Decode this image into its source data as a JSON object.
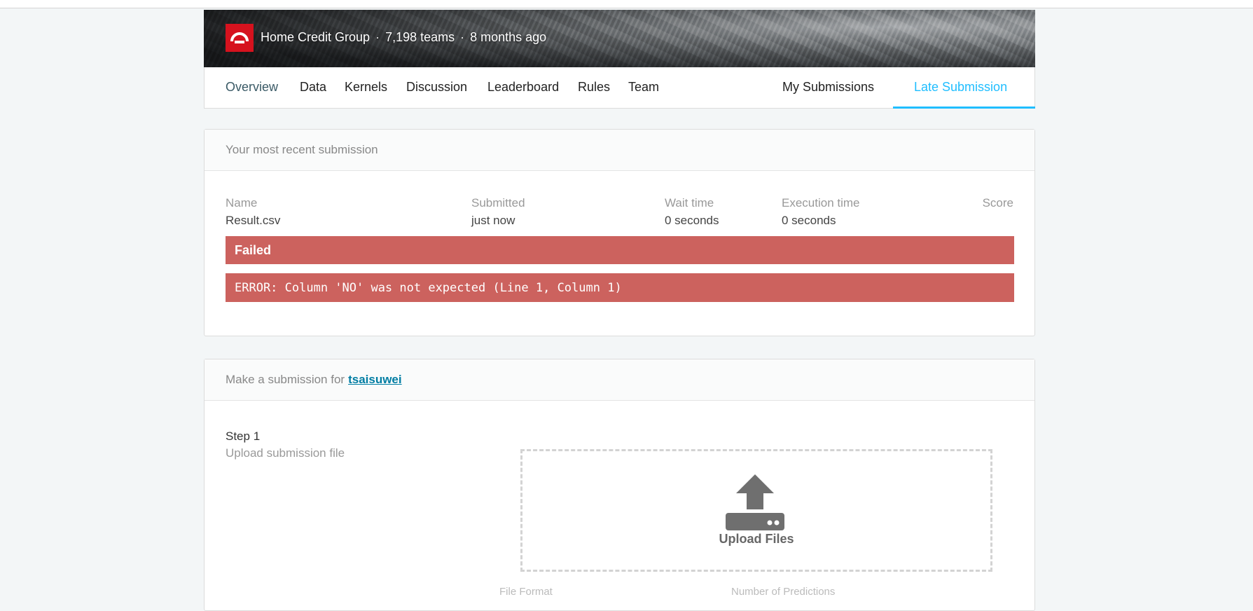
{
  "header": {
    "org": "Home Credit Group",
    "teams": "7,198 teams",
    "time": "8 months ago",
    "separator": "·"
  },
  "tabs": {
    "overview": "Overview",
    "data": "Data",
    "kernels": "Kernels",
    "discussion": "Discussion",
    "leaderboard": "Leaderboard",
    "rules": "Rules",
    "team": "Team",
    "my_submissions": "My Submissions",
    "late_submission": "Late Submission"
  },
  "recent": {
    "title": "Your most recent submission",
    "columns": {
      "name": "Name",
      "submitted": "Submitted",
      "wait": "Wait time",
      "exec": "Execution time",
      "score": "Score"
    },
    "values": {
      "name": "Result.csv",
      "submitted": "just now",
      "wait": "0 seconds",
      "exec": "0 seconds",
      "score": ""
    },
    "status": "Failed",
    "error": "ERROR: Column 'NO' was not expected (Line 1, Column 1)"
  },
  "make": {
    "prefix": "Make a submission for",
    "user": "tsaisuwei",
    "step_title": "Step 1",
    "step_sub": "Upload submission file",
    "upload_label": "Upload Files",
    "footer_left": "File Format",
    "footer_right": "Number of Predictions"
  },
  "colors": {
    "accent": "#20beff",
    "error": "#cc625e",
    "brand": "#d6121e",
    "link": "#007da3"
  },
  "icons": {
    "logo": "home-credit-logo",
    "upload": "upload-icon"
  }
}
